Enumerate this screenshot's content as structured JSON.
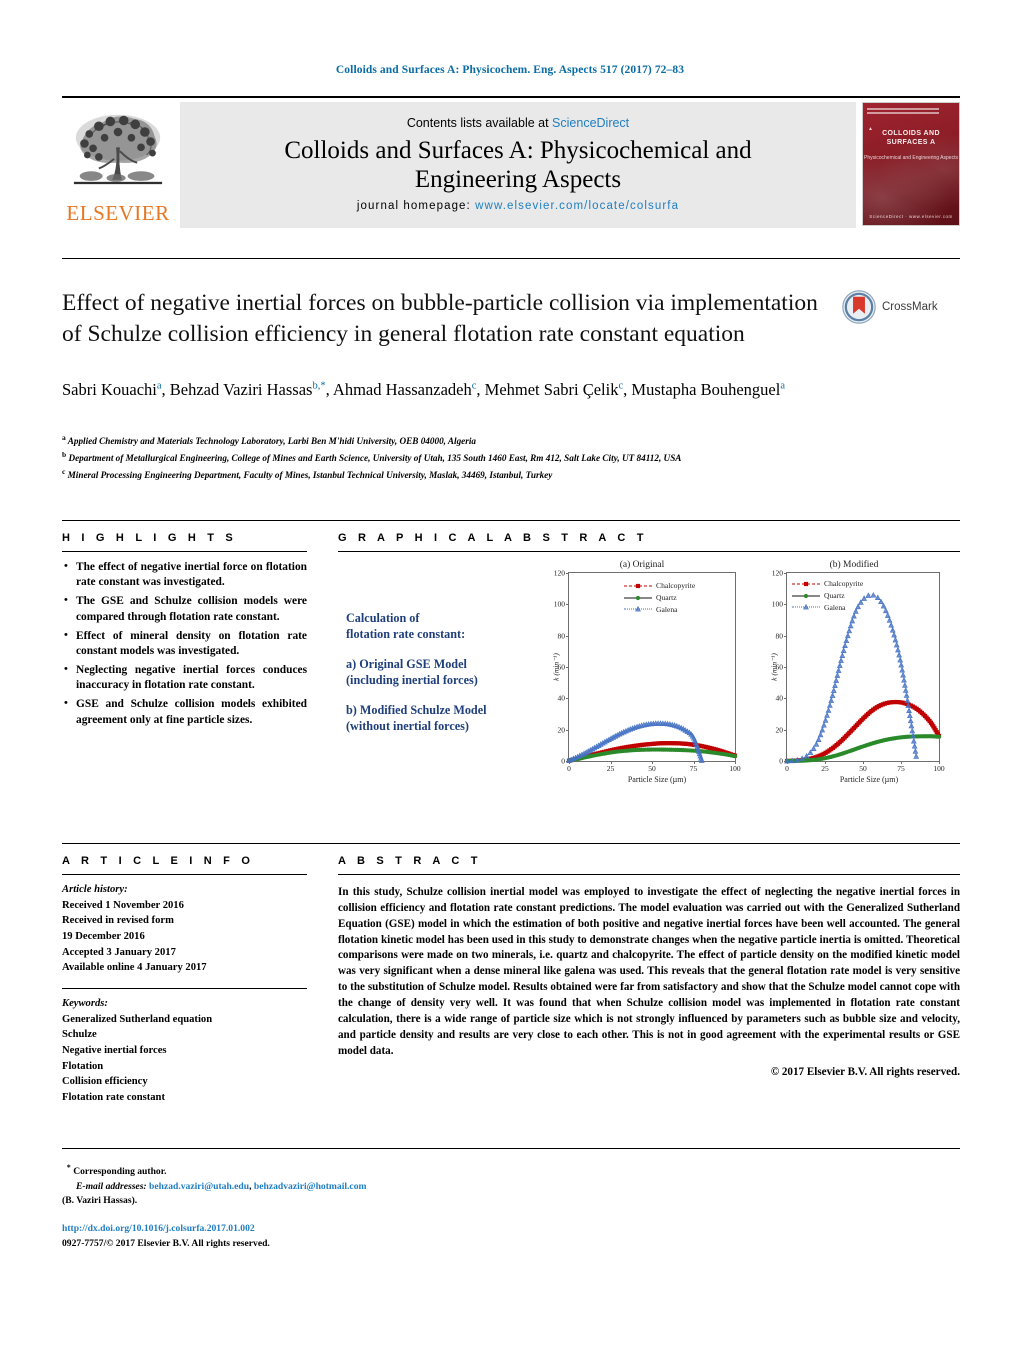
{
  "running_head": "Colloids and Surfaces A: Physicochem. Eng. Aspects 517 (2017) 72–83",
  "masthead": {
    "contents_prefix": "Contents lists available at ",
    "sciencedirect": "ScienceDirect",
    "journal_title_line1": "Colloids and Surfaces A: Physicochemical and",
    "journal_title_line2": "Engineering Aspects",
    "homepage_label": "journal homepage: ",
    "homepage_url": "www.elsevier.com/locate/colsurfa",
    "publisher": "ELSEVIER",
    "cover": {
      "title": "COLLOIDS AND SURFACES A",
      "subtitle": "Physicochemical and Engineering Aspects",
      "kicker": "An International Journal",
      "footer": "ScienceDirect  ·  www.elsevier.com"
    }
  },
  "article": {
    "title": "Effect of negative inertial forces on bubble-particle collision via implementation of Schulze collision efficiency in general flotation rate constant equation",
    "crossmark_label": "CrossMark",
    "authors_html": "Sabri Kouachi<sup>a</sup>, Behzad Vaziri Hassas<sup>b,</sup><sup>*</sup>, Ahmad Hassanzadeh<sup>c</sup>, Mehmet Sabri Çelik<sup>c</sup>, Mustapha Bouhenguel<sup>a</sup>",
    "affiliations": [
      "Applied Chemistry and Materials Technology Laboratory, Larbi Ben M'hidi University, OEB 04000, Algeria",
      "Department of Metallurgical Engineering, College of Mines and Earth Science, University of Utah, 135 South 1460 East, Rm 412, Salt Lake City, UT 84112, USA",
      "Mineral Processing Engineering Department, Faculty of Mines, Istanbul Technical University, Maslak, 34469, Istanbul, Turkey"
    ],
    "affiliation_marks": [
      "a",
      "b",
      "c"
    ]
  },
  "highlights": {
    "heading": "H I G H L I G H T S",
    "items": [
      "The effect of negative inertial force on flotation rate constant was investigated.",
      "The GSE and Schulze collision models were compared through flotation rate constant.",
      "Effect of mineral density on flotation rate constant models was investigated.",
      "Neglecting negative inertial forces conduces inaccuracy in flotation rate constant.",
      "GSE and Schulze collision models exhibited agreement only at fine particle sizes."
    ]
  },
  "graphical_abstract": {
    "heading": "G R A P H I C A L   A B S T R A C T",
    "caption_line1": "Calculation of",
    "caption_line2": "flotation rate constant:",
    "caption_a1": "a) Original GSE Model",
    "caption_a2": "(including inertial forces)",
    "caption_b1": "b) Modified Schulze Model",
    "caption_b2": "(without inertial forces)"
  },
  "chart_data": [
    {
      "type": "line",
      "title": "(a) Original",
      "xlabel": "Particle Size (µm)",
      "ylabel": "k (min⁻¹)",
      "xlim": [
        0,
        100
      ],
      "ylim": [
        0,
        120
      ],
      "xticks": [
        0,
        25,
        50,
        75,
        100
      ],
      "yticks": [
        0,
        20,
        40,
        60,
        80,
        100,
        120
      ],
      "grid": false,
      "legend_position": "top-right",
      "x": [
        0,
        5,
        10,
        15,
        20,
        25,
        30,
        35,
        40,
        45,
        50,
        55,
        60,
        65,
        70,
        75,
        80,
        85,
        90,
        95,
        100
      ],
      "series": [
        {
          "name": "Chalcopyrite",
          "color": "#c00000",
          "marker": "square",
          "linestyle": "dash-dot",
          "values": [
            0.2,
            1.4,
            2.8,
            4.2,
            5.5,
            6.8,
            7.9,
            8.9,
            9.7,
            10.4,
            10.9,
            11.3,
            11.4,
            11.3,
            11.0,
            10.4,
            9.5,
            8.3,
            6.9,
            5.2,
            3.4
          ]
        },
        {
          "name": "Quartz",
          "color": "#2a8a2a",
          "marker": "circle",
          "linestyle": "solid",
          "values": [
            0.2,
            1.2,
            2.4,
            3.5,
            4.5,
            5.4,
            6.1,
            6.6,
            7.0,
            7.2,
            7.3,
            7.3,
            7.2,
            7.1,
            6.9,
            6.6,
            6.2,
            5.6,
            4.9,
            4.1,
            3.1
          ]
        },
        {
          "name": "Galena",
          "color": "#4472c4",
          "marker": "triangle",
          "linestyle": "dotted",
          "values": [
            0.3,
            2.6,
            5.3,
            8.2,
            11.2,
            14.2,
            17.0,
            19.5,
            21.5,
            23.0,
            23.8,
            24.0,
            23.6,
            22.3,
            19.7,
            15.0,
            0.3,
            null,
            null,
            null,
            null
          ]
        }
      ]
    },
    {
      "type": "line",
      "title": "(b) Modified",
      "xlabel": "Particle Size (µm)",
      "ylabel": "k (min⁻¹)",
      "xlim": [
        0,
        100
      ],
      "ylim": [
        0,
        120
      ],
      "xticks": [
        0,
        25,
        50,
        75,
        100
      ],
      "yticks": [
        0,
        20,
        40,
        60,
        80,
        100,
        120
      ],
      "grid": false,
      "legend_position": "top-left",
      "x": [
        0,
        5,
        10,
        15,
        20,
        25,
        30,
        35,
        40,
        45,
        50,
        55,
        60,
        65,
        70,
        75,
        80,
        85,
        90,
        95,
        100
      ],
      "series": [
        {
          "name": "Chalcopyrite",
          "color": "#c00000",
          "marker": "square",
          "linestyle": "dash-dot",
          "values": [
            0.0,
            0.2,
            0.6,
            1.4,
            2.8,
            5.0,
            8.2,
            12.2,
            17.0,
            22.0,
            27.0,
            31.5,
            34.8,
            36.8,
            37.6,
            37.4,
            36.0,
            33.5,
            29.5,
            24.0,
            16.0
          ]
        },
        {
          "name": "Quartz",
          "color": "#2a8a2a",
          "marker": "circle",
          "linestyle": "solid",
          "values": [
            0.0,
            0.1,
            0.2,
            0.5,
            1.0,
            1.8,
            2.9,
            4.3,
            5.9,
            7.6,
            9.3,
            10.9,
            12.3,
            13.5,
            14.4,
            15.1,
            15.5,
            15.7,
            15.8,
            15.8,
            15.5
          ]
        },
        {
          "name": "Galena",
          "color": "#4472c4",
          "marker": "triangle",
          "linestyle": "dotted",
          "values": [
            0.0,
            0.4,
            1.6,
            5.0,
            12.0,
            25.0,
            42.0,
            62.0,
            80.0,
            95.0,
            103.0,
            106.0,
            104.0,
            96.0,
            82.0,
            62.0,
            34.0,
            3.0,
            null,
            null,
            null
          ]
        }
      ]
    }
  ],
  "article_info": {
    "heading": "A R T I C L E   I N F O",
    "history_label": "Article history:",
    "history": [
      "Received 1 November 2016",
      "Received in revised form",
      "19 December 2016",
      "Accepted 3 January 2017",
      "Available online 4 January 2017"
    ],
    "keywords_label": "Keywords:",
    "keywords": [
      "Generalized Sutherland equation",
      "Schulze",
      "Negative inertial forces",
      "Flotation",
      "Collision efficiency",
      "Flotation rate constant"
    ]
  },
  "abstract": {
    "heading": "A B S T R A C T",
    "body": "In this study, Schulze collision inertial model was employed to investigate the effect of neglecting the negative inertial forces in collision efficiency and flotation rate constant predictions. The model evaluation was carried out with the Generalized Sutherland Equation (GSE) model in which the estimation of both positive and negative inertial forces have been well accounted. The general flotation kinetic model has been used in this study to demonstrate changes when the negative particle inertia is omitted. Theoretical comparisons were made on two minerals, i.e. quartz and chalcopyrite. The effect of particle density on the modified kinetic model was very significant when a dense mineral like galena was used. This reveals that the general flotation rate model is very sensitive to the substitution of Schulze model. Results obtained were far from satisfactory and show that the Schulze model cannot cope with the change of density very well. It was found that when Schulze collision model was implemented in flotation rate constant calculation, there is a wide range of particle size which is not strongly influenced by parameters such as bubble size and velocity, and particle density and results are very close to each other. This is not in good agreement with the experimental results or GSE model data.",
    "copyright": "© 2017 Elsevier B.V. All rights reserved."
  },
  "footer": {
    "corresponding_author": "Corresponding author.",
    "email_label": "E-mail addresses:",
    "email1": "behzad.vaziri@utah.edu",
    "email_sep": ", ",
    "email2": "behzadvaziri@hotmail.com",
    "email_owner": "(B. Vaziri Hassas).",
    "doi": "http://dx.doi.org/10.1016/j.colsurfa.2017.01.002",
    "issn_line": "0927-7757/© 2017 Elsevier B.V. All rights reserved."
  }
}
